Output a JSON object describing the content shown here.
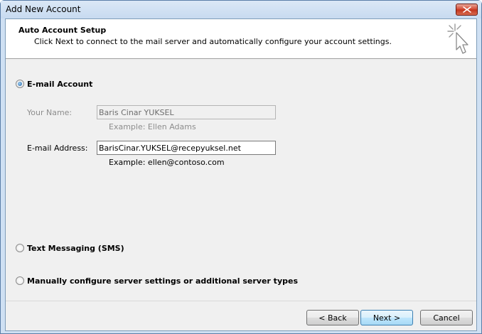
{
  "window": {
    "title": "Add New Account"
  },
  "header": {
    "title": "Auto Account Setup",
    "subtitle": "Click Next to connect to the mail server and automatically configure your account settings."
  },
  "options": {
    "email": {
      "label": "E-mail Account",
      "selected": true
    },
    "sms": {
      "label": "Text Messaging (SMS)",
      "selected": false
    },
    "manual": {
      "label": "Manually configure server settings or additional server types",
      "selected": false
    }
  },
  "form": {
    "name": {
      "label": "Your Name:",
      "value": "Baris Cinar YUKSEL",
      "example": "Example: Ellen Adams"
    },
    "email": {
      "label": "E-mail Address:",
      "value": "BarisCinar.YUKSEL@recepyuksel.net",
      "example": "Example: ellen@contoso.com"
    }
  },
  "buttons": {
    "back": "< Back",
    "next": "Next >",
    "cancel": "Cancel"
  },
  "icons": {
    "close": "close-icon",
    "wizard": "cursor-sparkle-icon"
  }
}
